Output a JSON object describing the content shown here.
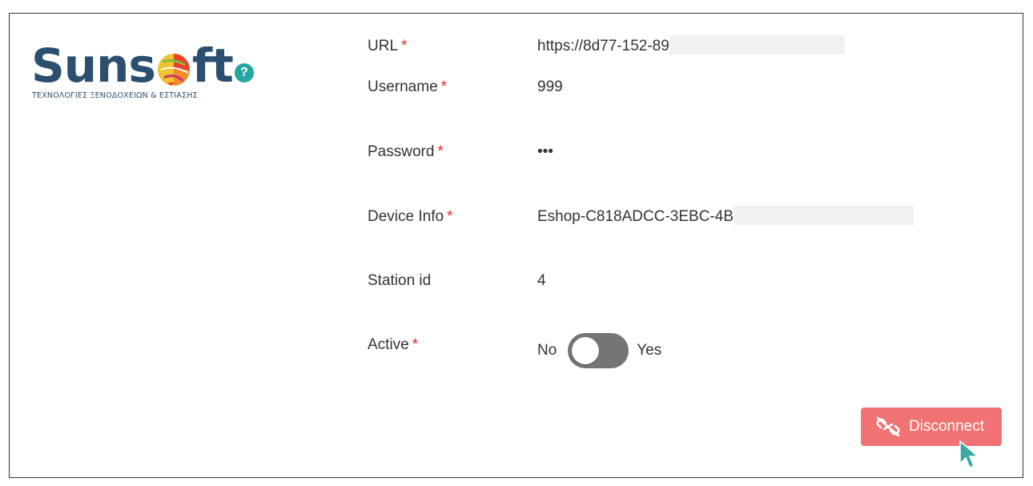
{
  "logo": {
    "word_left": "Suns",
    "word_right": "ft",
    "subtitle": "ΤΕΧΝΟΛΟΓΙΕΣ ΞΕΝΟΔΟΧΕΙΩΝ & ΕΣΤΙΑΣΗΣ",
    "brand_color": "#2b4f6e"
  },
  "help": {
    "icon": "question-circle-icon",
    "label": "?",
    "color": "#26a6a0"
  },
  "form": {
    "url": {
      "label": "URL",
      "required": "*",
      "value": "https://8d77-152-89"
    },
    "username": {
      "label": "Username",
      "required": "*",
      "value": "999"
    },
    "password": {
      "label": "Password",
      "required": "*",
      "value": "•••"
    },
    "device_info": {
      "label": "Device Info",
      "required": "*",
      "value": "Eshop-C818ADCC-3EBC-4B"
    },
    "station_id": {
      "label": "Station id",
      "value": "4"
    },
    "active": {
      "label": "Active",
      "required": "*",
      "off_label": "No",
      "on_label": "Yes",
      "state": "off"
    }
  },
  "actions": {
    "disconnect_label": "Disconnect",
    "disconnect_icon": "unlink-icon",
    "disconnect_color": "#f07272"
  }
}
